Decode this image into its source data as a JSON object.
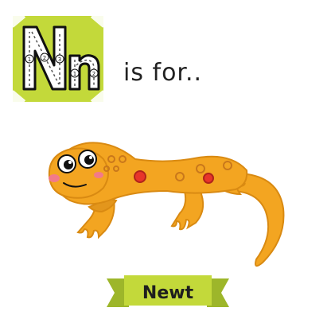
{
  "letter_card": {
    "uppercase": "N",
    "lowercase": "n",
    "stroke_numbers": [
      "1",
      "2",
      "3",
      "1",
      "2"
    ],
    "card_color": "#c3d93a"
  },
  "phrase": "is  for..",
  "word": "Newt",
  "colors": {
    "newt_body": "#f3a521",
    "newt_outline": "#d98a12",
    "newt_spots": "#c9781b",
    "newt_big_spot": "#e8352a",
    "cheek": "#f27a8a",
    "ribbon": "#c3d93a",
    "ribbon_dark": "#9db62a"
  }
}
